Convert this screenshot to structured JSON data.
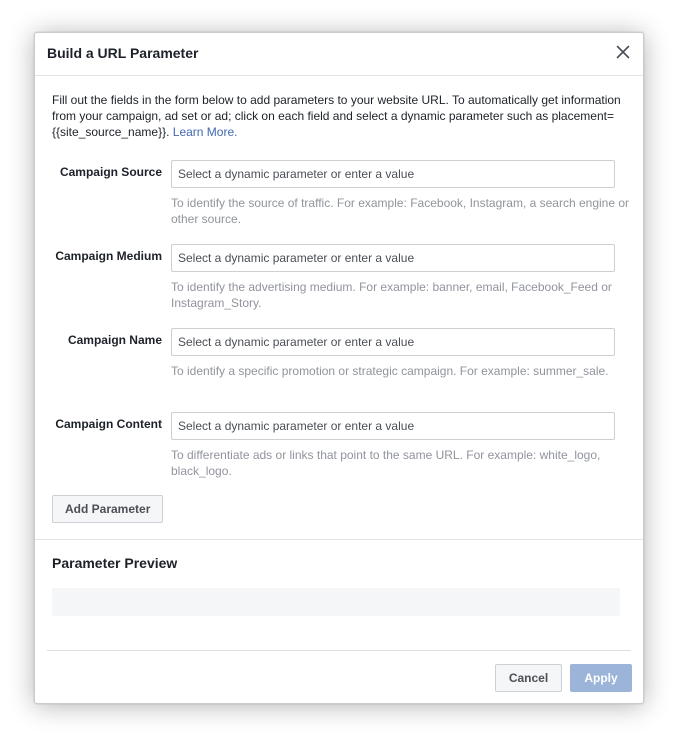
{
  "dialog": {
    "title": "Build a URL Parameter",
    "close_icon": "close-icon"
  },
  "intro": {
    "text": "Fill out the fields in the form below to add parameters to your website URL. To automatically get information from your campaign, ad set or ad; click on each field and select a dynamic parameter such as placement={{site_source_name}}.",
    "link_text": "Learn More."
  },
  "fields": [
    {
      "label": "Campaign Source",
      "value": "",
      "placeholder": "Select a dynamic parameter or enter a value",
      "help": "To identify the source of traffic. For example: Facebook, Instagram, a search engine or other source."
    },
    {
      "label": "Campaign Medium",
      "value": "",
      "placeholder": "Select a dynamic parameter or enter a value",
      "help": "To identify the advertising medium. For example: banner, email, Facebook_Feed or Instagram_Story."
    },
    {
      "label": "Campaign Name",
      "value": "",
      "placeholder": "Select a dynamic parameter or enter a value",
      "help": "To identify a specific promotion or strategic campaign. For example: summer_sale."
    },
    {
      "label": "Campaign Content",
      "value": "",
      "placeholder": "Select a dynamic parameter or enter a value",
      "help": "To differentiate ads or links that point to the same URL. For example: white_logo, black_logo."
    }
  ],
  "add_parameter_label": "Add Parameter",
  "preview": {
    "title": "Parameter Preview",
    "value": ""
  },
  "footer": {
    "cancel_label": "Cancel",
    "apply_label": "Apply"
  },
  "colors": {
    "link": "#4267b2",
    "apply_disabled": "#9cb4d8",
    "help_text": "#90949c"
  }
}
